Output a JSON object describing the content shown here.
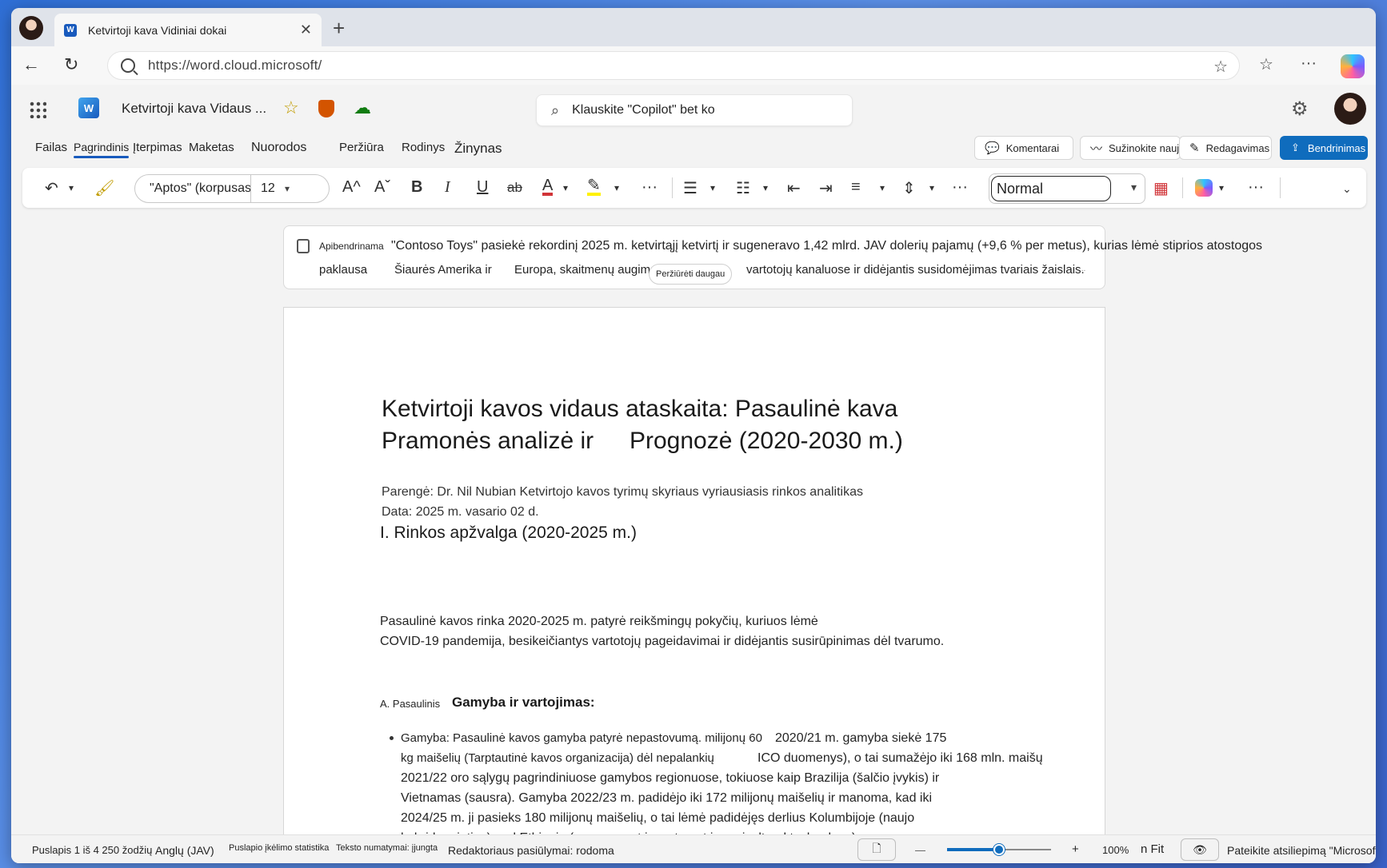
{
  "browser": {
    "tab_title": "Ketvirtoji kava Vidiniai dokai",
    "tab_close": "✕",
    "new_tab": "+",
    "url": "https://word.cloud.microsoft/",
    "back": "←",
    "refresh": "↻",
    "fav_add": "☆",
    "favorites": "☆",
    "more": "···"
  },
  "app": {
    "doc_title": "Ketvirtoji kava Vidaus ...",
    "word_logo": "W",
    "search_placeholder": "Klauskite \"Copilot\" bet ko",
    "settings": "⚙"
  },
  "ribbon_tabs": [
    {
      "label": "Failas"
    },
    {
      "label": "Pagrindinis",
      "active": true
    },
    {
      "label": "Įterpimas"
    },
    {
      "label": "Maketas"
    },
    {
      "label": "Nuorodos"
    },
    {
      "label": "Peržiūra"
    },
    {
      "label": "Rodinys"
    },
    {
      "label": "Žinynas"
    }
  ],
  "actions": {
    "comments": "Komentarai",
    "whats_new": "Sužinokite naujienas",
    "editing": "Redagavimas",
    "share": "Bendrinimas"
  },
  "toolbar": {
    "font_name": "\"Aptos\" (korpusas",
    "font_size": "12",
    "style": "Normal",
    "undo": "↶",
    "grow": "A^",
    "shrink": "Aˇ",
    "bold": "B",
    "italic": "I",
    "underline": "U",
    "strike": "ab",
    "more": "···"
  },
  "summary": {
    "label": "Apibendrinama",
    "line1": "\"Contoso Toys\" pasiekė rekordinį 2025 m. ketvirtąjį ketvirtį ir sugeneravo 1,42 mlrd. JAV dolerių pajamų (+9,6 % per metus), kurias lėmė stiprios atostogos",
    "line2a": "paklausa",
    "line2b": "Šiaurės Amerika ir",
    "line2c": "Europa, skaitmenų augimas",
    "line2d": "vartotojų kanaluose ir didėjantis susidomėjimas tvariais žaislais.",
    "see_more": "Peržiūrėti daugau",
    "ellipsis": "..."
  },
  "document": {
    "title_line1": "Ketvirtoji kavos vidaus ataskaita: Pasaulinė kava",
    "title_line2a": "Pramonės analizė ir",
    "title_line2b": "Prognozė (2020-2030 m.)",
    "prepared_by": "Parengė: Dr. Nil Nubian Ketvirtojo kavos tyrimų skyriaus vyriausiasis rinkos analitikas",
    "date": "Data: 2025 m. vasario 02 d.",
    "section1": "I. Rinkos apžvalga (2020-2025 m.)",
    "para1_line1": "Pasaulinė kavos rinka 2020-2025 m. patyrė reikšmingų pokyčių, kuriuos lėmė",
    "para1_line2": "COVID-19 pandemija, besikeičiantys vartotojų pageidavimai ir didėjantis susirūpinimas dėl tvarumo.",
    "sub_a_prefix": "A. Pasaulinis",
    "sub_a_title": "Gamyba ir vartojimas:",
    "bullet_lines": [
      [
        "Gamyba: Pasaulinė kavos gamyba patyrė nepastovumą. milijonų 60",
        "2020/21 m. gamyba siekė 175"
      ],
      [
        "kg maišelių (Tarptautinė kavos organizacija) dėl nepalankių",
        "ICO duomenys), o tai sumažėjo iki 168 mln. maišų"
      ],
      [
        "2021/22 oro sąlygų pagrindiniuose gamybos regionuose, tokiuose kaip Brazilija (šalčio įvykis) ir",
        ""
      ],
      [
        "Vietnamas (sausra). Gamyba 2022/23 m. padidėjo iki 172 milijonų maišelių ir manoma, kad iki",
        ""
      ],
      [
        "2024/25 m. ji pasieks 180 milijonų maišelių, o tai lėmė padidėjęs derlius Kolumbijoje (naujo",
        ""
      ],
      [
        "hybrid varieties) and Ethiopia (government investment in agricultural technology).",
        ""
      ]
    ]
  },
  "status": {
    "page": "Puslapis 1 iš 4 250 žodžių",
    "language": "Anglų (JAV)",
    "load_stats": "Puslapio įkėlimo statistika",
    "text_predictions": "Teksto numatymai: įjungta",
    "editor": "Redaktoriaus pasiūlymai: rodoma",
    "zoom_out": "—",
    "zoom_in": "+",
    "zoom": "100%",
    "fit": "n Fit",
    "feedback": "Pateikite atsiliepimą \"Microsoft\"",
    "zoom_level": 0.5
  }
}
